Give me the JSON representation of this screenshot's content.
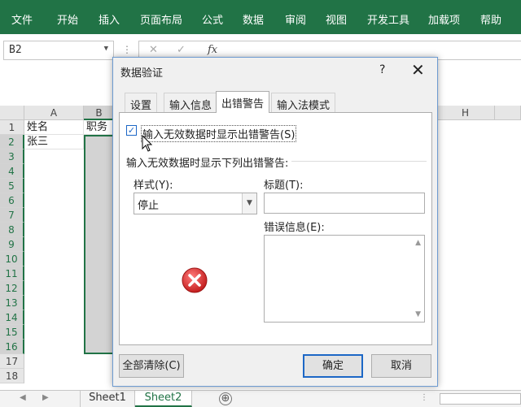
{
  "ribbon": {
    "tabs": [
      "文件",
      "开始",
      "插入",
      "页面布局",
      "公式",
      "数据",
      "审阅",
      "视图",
      "开发工具",
      "加载项",
      "帮助"
    ]
  },
  "formula_bar": {
    "name_box": "B2",
    "cancel_icon": "✕",
    "enter_icon": "✓",
    "fx_label": "fx"
  },
  "grid": {
    "columns": [
      "A",
      "B",
      "H"
    ],
    "rows": [
      "1",
      "2",
      "3",
      "4",
      "5",
      "6",
      "7",
      "8",
      "9",
      "10",
      "11",
      "12",
      "13",
      "14",
      "15",
      "16",
      "17",
      "18"
    ],
    "cells": {
      "A1": "姓名",
      "B1": "职务",
      "A2": "张三"
    }
  },
  "sheets": {
    "tabs": [
      "Sheet1",
      "Sheet2"
    ],
    "active": "Sheet2",
    "add_icon": "⊕"
  },
  "dialog": {
    "title": "数据验证",
    "help": "?",
    "close": "✕",
    "tabs": [
      "设置",
      "输入信息",
      "出错警告",
      "输入法模式"
    ],
    "active_tab": "出错警告",
    "checkbox_label": "输入无效数据时显示出错警告(S)",
    "checkbox_checked": true,
    "group_label": "输入无效数据时显示下列出错警告:",
    "style_label": "样式(Y):",
    "style_value": "停止",
    "title_label": "标题(T):",
    "title_value": "",
    "message_label": "错误信息(E):",
    "message_value": "",
    "icon": "stop-error-icon",
    "buttons": {
      "clear_all": "全部清除(C)",
      "ok": "确定",
      "cancel": "取消"
    }
  },
  "colors": {
    "ribbon": "#217346",
    "accent": "#1c67c6",
    "stop_icon": "#d32f2f"
  }
}
